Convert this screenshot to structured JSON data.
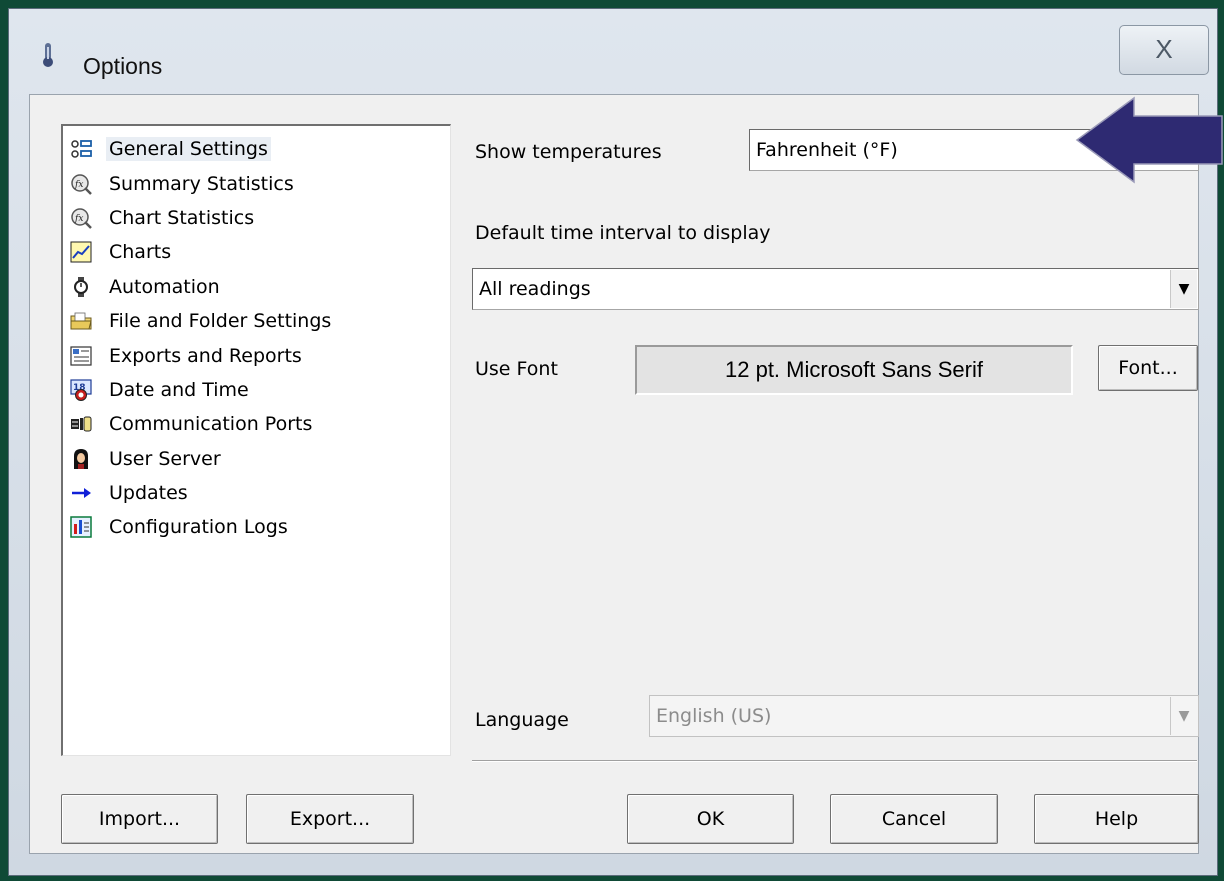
{
  "window": {
    "title": "Options",
    "close_label": "X"
  },
  "nav": {
    "items": [
      {
        "label": "General Settings",
        "icon": "list-icon",
        "selected": true
      },
      {
        "label": "Summary Statistics",
        "icon": "fx-magnifier-icon"
      },
      {
        "label": "Chart Statistics",
        "icon": "fx-magnifier-icon"
      },
      {
        "label": "Charts",
        "icon": "line-chart-icon"
      },
      {
        "label": "Automation",
        "icon": "watch-icon"
      },
      {
        "label": "File and Folder Settings",
        "icon": "folder-icon"
      },
      {
        "label": "Exports and Reports",
        "icon": "report-icon"
      },
      {
        "label": "Date and Time",
        "icon": "calendar-icon"
      },
      {
        "label": "Communication Ports",
        "icon": "ports-icon"
      },
      {
        "label": "User Server",
        "icon": "user-icon"
      },
      {
        "label": "Updates",
        "icon": "arrow-right-icon"
      },
      {
        "label": "Configuration Logs",
        "icon": "log-icon"
      }
    ]
  },
  "settings": {
    "show_temperatures_label": "Show temperatures",
    "show_temperatures_value": "Fahrenheit (°F)",
    "time_interval_label": "Default time interval to display",
    "time_interval_value": "All readings",
    "use_font_label": "Use Font",
    "font_value": "12 pt. Microsoft Sans Serif",
    "font_button": "Font...",
    "language_label": "Language",
    "language_value": "English (US)"
  },
  "buttons": {
    "import": "Import...",
    "export": "Export...",
    "ok": "OK",
    "cancel": "Cancel",
    "help": "Help"
  },
  "colors": {
    "background": "#0f4a36",
    "annotation_arrow": "#2e2a72"
  }
}
